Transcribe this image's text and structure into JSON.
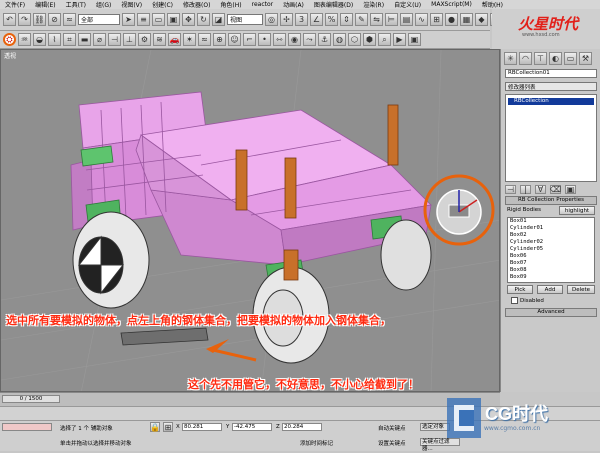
{
  "menubar": [
    "文件(F)",
    "编辑(E)",
    "工具(T)",
    "组(G)",
    "视图(V)",
    "创建(C)",
    "修改器(O)",
    "角色(H)",
    "reactor",
    "动画(A)",
    "图表编辑器(D)",
    "渲染(R)",
    "自定义(U)",
    "MAXScript(M)",
    "帮助(H)"
  ],
  "toolbar": {
    "selection_filter": "全部",
    "ref_coord": "视图"
  },
  "logo": {
    "text": "火星时代",
    "url": "www.hxsd.com"
  },
  "viewport": {
    "label": "透视"
  },
  "panel": {
    "object_name": "RBCollection01",
    "modifier_list": "修改器列表",
    "stack_item": "RBCollection",
    "rollout_title": "RB Collection Properties",
    "rigid_bodies_label": "Rigid Bodies",
    "highlight_label": "highlight",
    "bodies": [
      "Box01",
      "Cylinder01",
      "Box02",
      "Cylinder02",
      "Cylinder05",
      "Box06",
      "Box07",
      "Box08",
      "Box09"
    ],
    "pick_label": "Pick",
    "add_label": "Add",
    "delete_label": "Delete",
    "disabled_label": "Disabled",
    "advanced_label": "Advanced"
  },
  "timeline": {
    "position": "0 / 1500"
  },
  "status": {
    "selection": "选择了 1 个 辅助对象",
    "prompt": "单击并拖动以选择并移动对象",
    "x": "80.281",
    "y": "-42.475",
    "z": "20.284",
    "add_time_tag": "添加时间标记",
    "auto_key": "自动关键点",
    "set_key": "设置关键点",
    "selected": "选定对象",
    "key_filters": "关键点过滤器..."
  },
  "annotations": {
    "line1": "选中所有要模拟的物体，点左上角的钢体集合，把要模拟的物体加入钢体集合，",
    "line2": "这个先不用管它，不好意思，不小心给截到了！"
  },
  "watermark": {
    "text": "CG时代",
    "url": "www.cgmo.com.cn"
  },
  "colors": {
    "accent": "#e8620c",
    "annotation": "#ff2a10",
    "model": "#e59be6"
  }
}
